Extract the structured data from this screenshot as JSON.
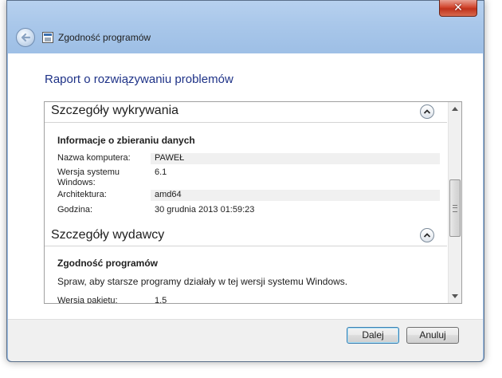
{
  "window": {
    "title": "Zgodność programów",
    "close_label": "✕"
  },
  "report": {
    "title": "Raport o rozwiązywaniu problemów"
  },
  "detection": {
    "header": "Szczegóły wykrywania",
    "subheading": "Informacje o zbieraniu danych",
    "rows": [
      {
        "label": "Nazwa komputera:",
        "value": "PAWEŁ"
      },
      {
        "label": "Wersja systemu Windows:",
        "value": "6.1"
      },
      {
        "label": "Architektura:",
        "value": "amd64"
      },
      {
        "label": "Godzina:",
        "value": "30 grudnia 2013 01:59:23"
      }
    ]
  },
  "publisher": {
    "header": "Szczegóły wydawcy",
    "subheading": "Zgodność programów",
    "description": "Spraw, aby starsze programy działały w tej wersji systemu Windows.",
    "rows": [
      {
        "label": "Wersja pakietu:",
        "value": "1.5"
      }
    ]
  },
  "footer": {
    "next_label": "Dalej",
    "cancel_label": "Anuluj"
  },
  "icons": {
    "back": "back-arrow-icon",
    "app": "program-compatibility-icon",
    "collapse": "chevron-up-icon",
    "close": "close-icon"
  }
}
